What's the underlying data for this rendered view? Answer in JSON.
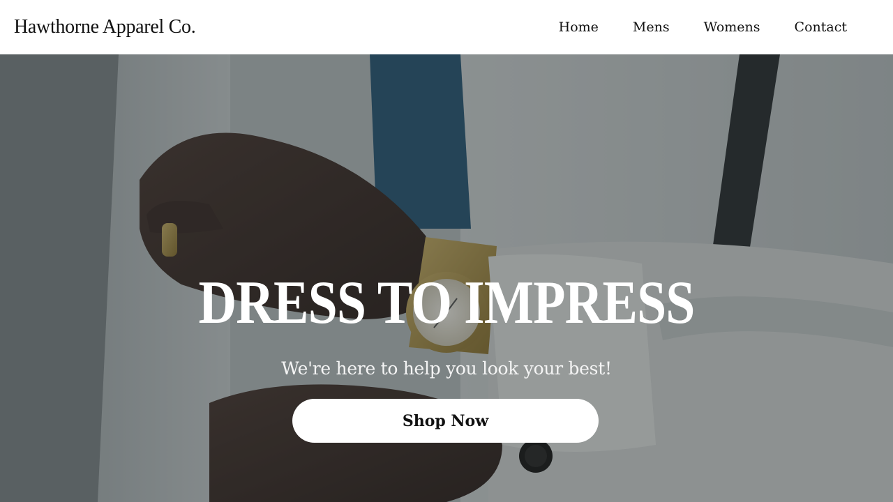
{
  "brand": {
    "name": "Hawthorne Apparel Co."
  },
  "nav": {
    "items": [
      {
        "label": "Home"
      },
      {
        "label": "Mens"
      },
      {
        "label": "Womens"
      },
      {
        "label": "Contact"
      }
    ]
  },
  "hero": {
    "headline": "DRESS TO IMPRESS",
    "subtext": "We're here to help you look your best!",
    "cta_label": "Shop Now",
    "background_description": "man-fastening-cufflink-with-gold-watch"
  },
  "colors": {
    "nav_background": "#ffffff",
    "text_dark": "#111111",
    "hero_text": "#ffffff",
    "button_background": "#ffffff"
  }
}
